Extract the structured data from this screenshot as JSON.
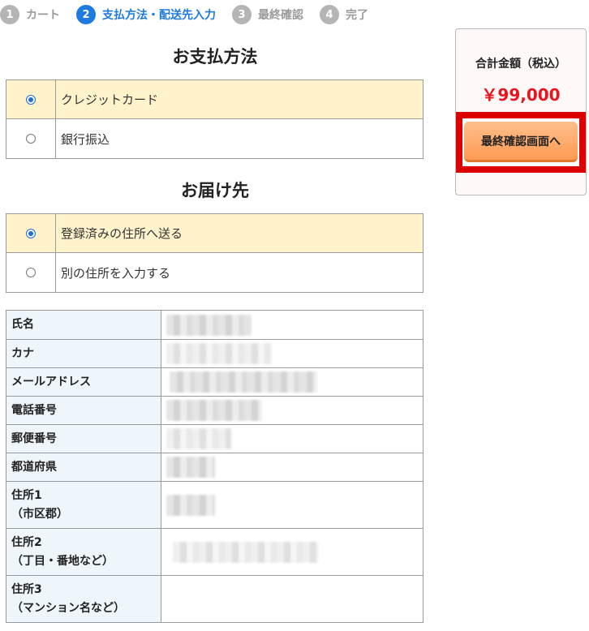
{
  "steps": [
    {
      "number": "1",
      "label": "カート"
    },
    {
      "number": "2",
      "label": "支払方法・配送先入力"
    },
    {
      "number": "3",
      "label": "最終確認"
    },
    {
      "number": "4",
      "label": "完了"
    }
  ],
  "active_step": "2",
  "payment": {
    "title": "お支払方法",
    "options": [
      {
        "label": "クレジットカード",
        "selected": true
      },
      {
        "label": "銀行振込",
        "selected": false
      }
    ]
  },
  "delivery": {
    "title": "お届け先",
    "options": [
      {
        "label": "登録済みの住所へ送る",
        "selected": true
      },
      {
        "label": "別の住所を入力する",
        "selected": false
      }
    ]
  },
  "address": {
    "rows": [
      {
        "label": "氏名",
        "sub": ""
      },
      {
        "label": "カナ",
        "sub": ""
      },
      {
        "label": "メールアドレス",
        "sub": ""
      },
      {
        "label": "電話番号",
        "sub": ""
      },
      {
        "label": "郵便番号",
        "sub": ""
      },
      {
        "label": "都道府県",
        "sub": ""
      },
      {
        "label": "住所1",
        "sub": "（市区郡）"
      },
      {
        "label": "住所2",
        "sub": "（丁目・番地など）"
      },
      {
        "label": "住所3",
        "sub": "（マンション名など）"
      }
    ]
  },
  "summary": {
    "total_label": "合計金額（税込）",
    "total_value": "￥99,000",
    "button_label": "最終確認画面へ"
  },
  "colors": {
    "accent": "#1f7ae0",
    "price": "#e8141e",
    "highlight": "#dc0000",
    "selected_row": "#fff3cc",
    "button": "#ff9a52"
  }
}
